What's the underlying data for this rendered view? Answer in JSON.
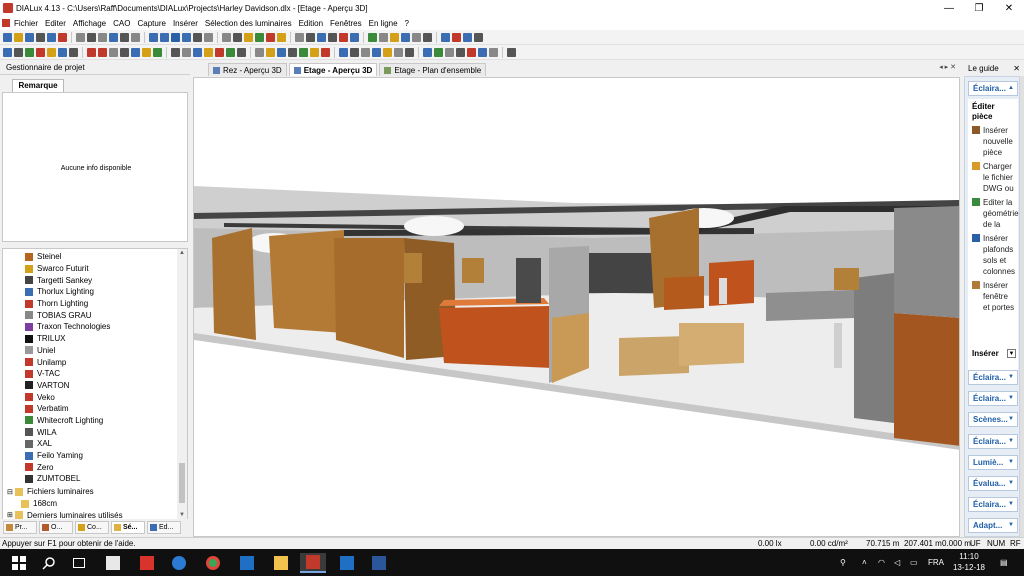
{
  "window": {
    "title": "DIALux 4.13 - C:\\Users\\Raff\\Documents\\DIALux\\Projects\\Harley Davidson.dlx - [Etage - Aperçu 3D]",
    "min": "—",
    "max": "❐",
    "close": "✕"
  },
  "menu": [
    "Fichier",
    "Editer",
    "Affichage",
    "CAO",
    "Capture",
    "Insérer",
    "Sélection des luminaires",
    "Edition",
    "Fenêtres",
    "En ligne",
    "?"
  ],
  "project_manager": {
    "title": "Gestionnaire de projet",
    "tab": "Remarque",
    "info": "Aucune info disponible"
  },
  "tree": {
    "items": [
      {
        "label": "Steinel",
        "icon_color": "#b5651d"
      },
      {
        "label": "Swarco Futurit",
        "icon_color": "#d4a017"
      },
      {
        "label": "Targetti Sankey",
        "icon_color": "#444444"
      },
      {
        "label": "Thorlux Lighting",
        "icon_color": "#3b6db3"
      },
      {
        "label": "Thorn Lighting",
        "icon_color": "#c0392b"
      },
      {
        "label": "TOBIAS GRAU",
        "icon_color": "#888888"
      },
      {
        "label": "Traxon Technologies",
        "icon_color": "#7a3fa0"
      },
      {
        "label": "TRILUX",
        "icon_color": "#111111"
      },
      {
        "label": "Uniel",
        "icon_color": "#999999"
      },
      {
        "label": "Unilamp",
        "icon_color": "#c0392b"
      },
      {
        "label": "V-TAC",
        "icon_color": "#c0392b"
      },
      {
        "label": "VARTON",
        "icon_color": "#222222"
      },
      {
        "label": "Veko",
        "icon_color": "#c0392b"
      },
      {
        "label": "Verbatim",
        "icon_color": "#c0392b"
      },
      {
        "label": "Whitecroft Lighting",
        "icon_color": "#3a8a3a"
      },
      {
        "label": "WILA",
        "icon_color": "#555555"
      },
      {
        "label": "XAL",
        "icon_color": "#666666"
      },
      {
        "label": "Feilo Yaming",
        "icon_color": "#3b6db3"
      },
      {
        "label": "Zero",
        "icon_color": "#c0392b"
      },
      {
        "label": "ZUMTOBEL",
        "icon_color": "#333333"
      }
    ],
    "folders": [
      {
        "label": "Fichiers luminaires"
      },
      {
        "label": "168cm"
      },
      {
        "label": "Derniers luminaires utilisés"
      }
    ]
  },
  "bottom_tabs": [
    "Pr...",
    "O...",
    "Co...",
    "Sé...",
    "Ed..."
  ],
  "center_tabs": [
    {
      "label": "Rez - Aperçu 3D"
    },
    {
      "label": "Etage - Aperçu 3D"
    },
    {
      "label": "Etage - Plan d'ensemble"
    }
  ],
  "center_tab_controls": "◂ ▸ ✕",
  "guide": {
    "title": "Le guide",
    "close": "✕",
    "top_category": "Éclaira...",
    "section_title": "Éditer pièce",
    "items": [
      {
        "label": "Insérer nouvelle pièce",
        "icon_color": "#8b5a2b"
      },
      {
        "label": "Charger le fichier DWG ou",
        "icon_color": "#d89a2b"
      },
      {
        "label": "Editer la géométrie de la",
        "icon_color": "#3a8a3a"
      },
      {
        "label": "Insérer plafonds sols et colonnes",
        "icon_color": "#2b5fa8"
      },
      {
        "label": "Insérer fenêtre et portes",
        "icon_color": "#b07a3a"
      }
    ],
    "insert_label": "Insérer",
    "categories": [
      "Éclaira...",
      "Éclaira...",
      "Scènes...",
      "Éclaira...",
      "Lumiè...",
      "Évalua...",
      "Éclaira...",
      "Adapt..."
    ]
  },
  "status": {
    "help": "Appuyer sur F1 pour obtenir de l'aide.",
    "lux": "0.00 lx",
    "luminance": "0.00 cd/m²",
    "x": "70.715 m",
    "y": "207.401 m",
    "z": "0.000 m",
    "uf": "UF",
    "num": "NUM",
    "rf": "RF"
  },
  "taskbar": {
    "time": "11:10",
    "date": "13-12-18",
    "lang": "FRA"
  }
}
